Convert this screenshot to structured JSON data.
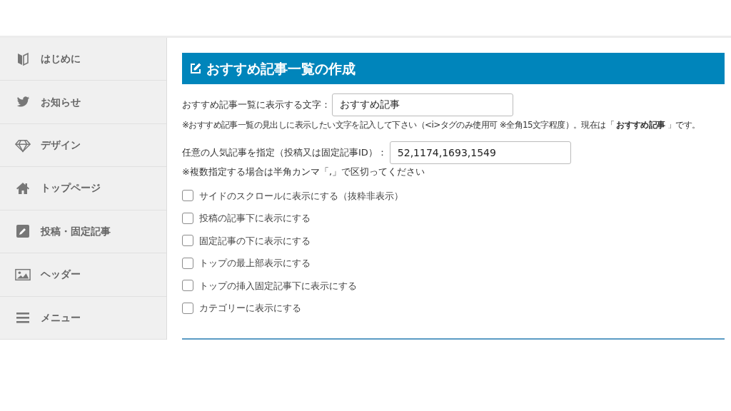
{
  "sidebar": {
    "items": [
      {
        "label": "はじめに"
      },
      {
        "label": "お知らせ"
      },
      {
        "label": "デザイン"
      },
      {
        "label": "トップページ"
      },
      {
        "label": "投稿・固定記事"
      },
      {
        "label": "ヘッダー"
      },
      {
        "label": "メニュー"
      }
    ]
  },
  "section": {
    "title": "おすすめ記事一覧の作成",
    "heading_field": {
      "label": "おすすめ記事一覧に表示する文字：",
      "value": "おすすめ記事",
      "hint": "※おすすめ記事一覧の見出しに表示したい文字を記入して下さい（<i>タグのみ使用可 ※全角15文字程度）。現在は「 **おすすめ記事** 」です。"
    },
    "ids_field": {
      "label": "任意の人気記事を指定（投稿又は固定記事ID）：",
      "value": "52,1174,1693,1549",
      "hint": "※複数指定する場合は半角カンマ「,」で区切ってください"
    },
    "options": [
      {
        "label": "サイドのスクロールに表示にする（抜粋非表示）",
        "checked": false
      },
      {
        "label": "投稿の記事下に表示にする",
        "checked": false
      },
      {
        "label": "固定記事の下に表示にする",
        "checked": false
      },
      {
        "label": "トップの最上部表示にする",
        "checked": false
      },
      {
        "label": "トップの挿入固定記事下に表示にする",
        "checked": false
      },
      {
        "label": "カテゴリーに表示にする",
        "checked": false
      }
    ]
  }
}
